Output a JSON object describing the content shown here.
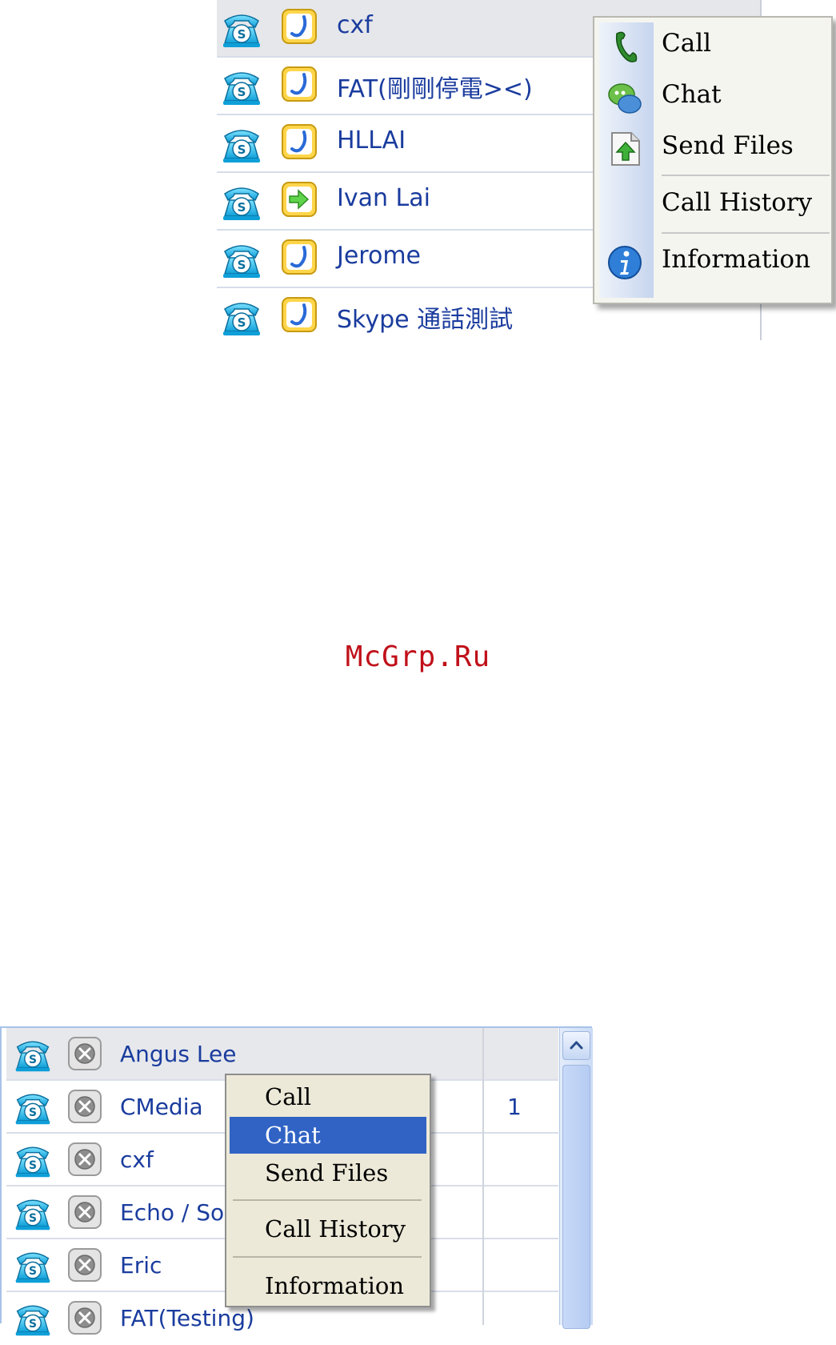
{
  "top_panel": {
    "contacts": [
      {
        "name": "cxf",
        "status": "phone",
        "selected": true
      },
      {
        "name": "FAT(剛剛停電><)",
        "status": "phone",
        "selected": false
      },
      {
        "name": "HLLAI",
        "status": "phone",
        "selected": false
      },
      {
        "name": "Ivan Lai",
        "status": "arrow",
        "selected": false
      },
      {
        "name": "Jerome",
        "status": "phone",
        "selected": false
      },
      {
        "name": "Skype 通話測試",
        "status": "phone",
        "selected": false
      }
    ],
    "menu": {
      "call": "Call",
      "chat": "Chat",
      "send_files": "Send Files",
      "call_history": "Call History",
      "information": "Information"
    }
  },
  "watermark": "McGrp.Ru",
  "bottom_panel": {
    "contacts": [
      {
        "name": "Angus Lee",
        "count": "",
        "selected": true
      },
      {
        "name": "CMedia",
        "count": "1",
        "selected": false
      },
      {
        "name": "cxf",
        "count": "",
        "selected": false
      },
      {
        "name": "Echo / Sou",
        "count": "",
        "selected": false
      },
      {
        "name": "Eric",
        "count": "",
        "selected": false
      },
      {
        "name": "FAT(Testing)",
        "count": "",
        "selected": false
      }
    ],
    "menu": {
      "call": "Call",
      "chat": "Chat",
      "send_files": "Send Files",
      "call_history": "Call History",
      "information": "Information",
      "highlighted": "Chat"
    }
  },
  "colors": {
    "contact_name": "#1a3c9e",
    "menu_highlight": "#3163c5",
    "watermark": "#c0101a"
  }
}
